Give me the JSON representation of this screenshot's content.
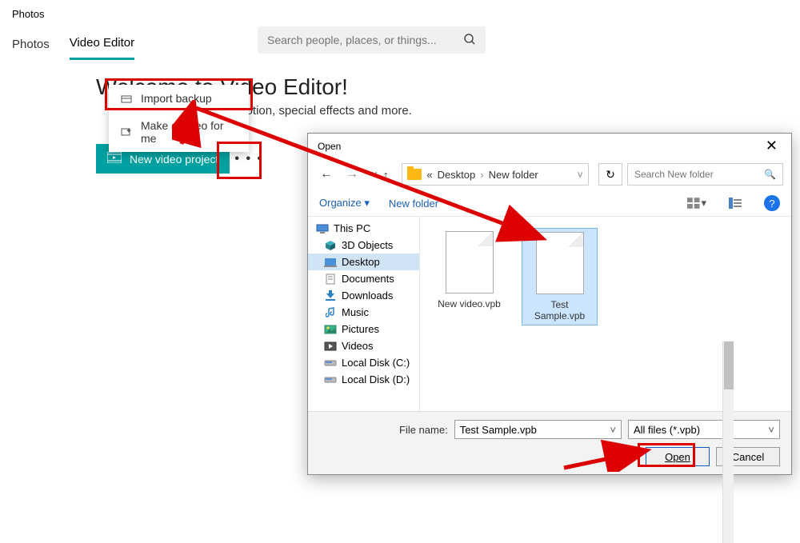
{
  "app_title": "Photos",
  "tabs": {
    "photos": "Photos",
    "video_editor": "Video Editor"
  },
  "search": {
    "placeholder": "Search people, places, or things..."
  },
  "heading": "Welcome to Video Editor!",
  "subtitle_fragment": "motion, special effects and more.",
  "menu": {
    "import_backup": "Import backup",
    "make_video": "Make a video for me"
  },
  "buttons": {
    "new_project": "New video project",
    "more": "• • •"
  },
  "dialog": {
    "title": "Open",
    "breadcrumb": {
      "prefix": "«",
      "part1": "Desktop",
      "part2": "New folder"
    },
    "refresh_tip": "↻",
    "search_placeholder": "Search New folder",
    "organize": "Organize",
    "new_folder": "New folder",
    "tree": {
      "this_pc": "This PC",
      "objects3d": "3D Objects",
      "desktop": "Desktop",
      "documents": "Documents",
      "downloads": "Downloads",
      "music": "Music",
      "pictures": "Pictures",
      "videos": "Videos",
      "disk_c": "Local Disk (C:)",
      "disk_d": "Local Disk (D:)"
    },
    "files": {
      "f1": "New video.vpb",
      "f2": "Test Sample.vpb"
    },
    "file_name_label": "File name:",
    "file_name_value": "Test Sample.vpb",
    "filter": "All files (*.vpb)",
    "open": "Open",
    "cancel": "Cancel"
  }
}
